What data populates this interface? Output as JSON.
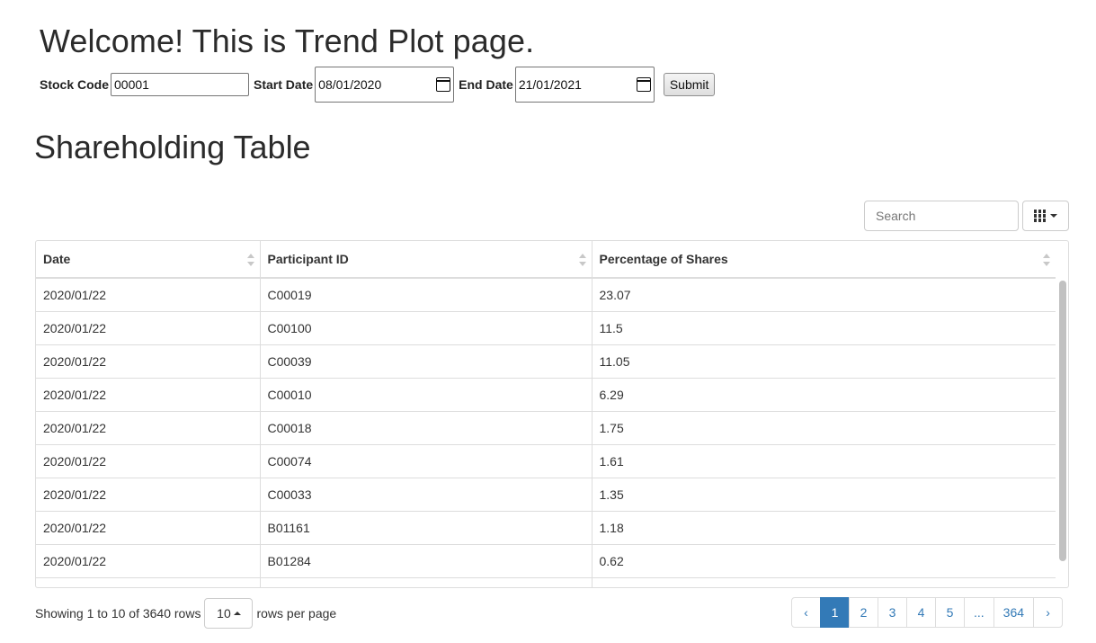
{
  "header": {
    "title": "Welcome! This is Trend Plot page."
  },
  "form": {
    "stock_code_label": "Stock Code",
    "stock_code_value": "00001",
    "start_date_label": "Start Date",
    "start_date_value": "08/01/2020",
    "end_date_label": "End Date",
    "end_date_value": "21/01/2021",
    "submit_label": "Submit"
  },
  "section": {
    "title": "Shareholding Table"
  },
  "toolbar": {
    "search_placeholder": "Search",
    "columns_icon": "grid-icon"
  },
  "table": {
    "columns": [
      "Date",
      "Participant ID",
      "Percentage of Shares"
    ],
    "rows": [
      [
        "2020/01/22",
        "C00019",
        "23.07"
      ],
      [
        "2020/01/22",
        "C00100",
        "11.5"
      ],
      [
        "2020/01/22",
        "C00039",
        "11.05"
      ],
      [
        "2020/01/22",
        "C00010",
        "6.29"
      ],
      [
        "2020/01/22",
        "C00018",
        "1.75"
      ],
      [
        "2020/01/22",
        "C00074",
        "1.61"
      ],
      [
        "2020/01/22",
        "C00033",
        "1.35"
      ],
      [
        "2020/01/22",
        "B01161",
        "1.18"
      ],
      [
        "2020/01/22",
        "B01284",
        "0.62"
      ]
    ]
  },
  "footer": {
    "showing_text": "Showing 1 to 10 of 3640 rows",
    "page_size": "10",
    "rows_per_page_label": "rows per page"
  },
  "pagination": {
    "prev": "‹",
    "pages": [
      "1",
      "2",
      "3",
      "4",
      "5",
      "...",
      "364"
    ],
    "active": "1",
    "next": "›"
  }
}
